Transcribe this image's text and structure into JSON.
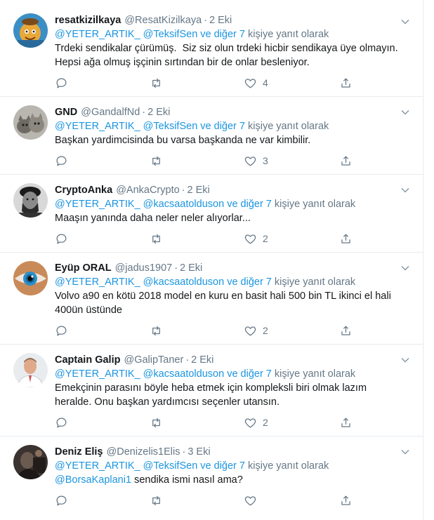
{
  "tweets": [
    {
      "name": "resatkizilkaya",
      "handle": "@ResatKizilkaya",
      "time": "2 Eki",
      "reply_to": {
        "m1": "@YETER_ARTIK_",
        "m2": "@TeksifSen",
        "others": "ve diğer 7",
        "suffix": "kişiye yanıt olarak"
      },
      "lines": [
        "Trdeki sendikalar çürümüş.  Siz siz olun trdeki hicbir sendikaya üye olmayın.",
        "Hepsi ağa olmuş işçinin sırtından bir de onlar besleniyor."
      ],
      "likes": "4",
      "avatar_icon": "cartoon-avatar"
    },
    {
      "name": "GND",
      "handle": "@GandalfNd",
      "time": "2 Eki",
      "reply_to": {
        "m1": "@YETER_ARTIK_",
        "m2": "@TeksifSen",
        "others": "ve diğer 7",
        "suffix": "kişiye yanıt olarak"
      },
      "lines": [
        "Başkan yardimcisinda bu varsa başkanda ne var kimbilir."
      ],
      "likes": "3",
      "avatar_icon": "cats-avatar"
    },
    {
      "name": "CryptoAnka",
      "handle": "@AnkaCrypto",
      "time": "2 Eki",
      "reply_to": {
        "m1": "@YETER_ARTIK_",
        "m2": "@kacsaatolduson",
        "others": "ve diğer 7",
        "suffix": "kişiye yanıt olarak"
      },
      "lines": [
        "Maaşın yanında daha neler neler alıyorlar..."
      ],
      "likes": "2",
      "avatar_icon": "portrait-bw-avatar"
    },
    {
      "name": "Eyüp ORAL",
      "handle": "@jadus1907",
      "time": "2 Eki",
      "reply_to": {
        "m1": "@YETER_ARTIK_",
        "m2": "@kacsaatolduson",
        "others": "ve diğer 7",
        "suffix": "kişiye yanıt olarak"
      },
      "lines": [
        "Volvo a90 en kötü 2018 model en kuru en basit hali 500 bin TL ikinci el hali",
        "400ün üstünde"
      ],
      "likes": "2",
      "avatar_icon": "eye-avatar"
    },
    {
      "name": "Captain Galip",
      "handle": "@GalipTaner",
      "time": "2 Eki",
      "reply_to": {
        "m1": "@YETER_ARTIK_",
        "m2": "@kacsaatolduson",
        "others": "ve diğer 7",
        "suffix": "kişiye yanıt olarak"
      },
      "lines": [
        "Emekçinin parasını böyle heba etmek için kompleksli biri olmak lazım",
        "heralde. Onu başkan yardımcısı seçenler utansın."
      ],
      "likes": "2",
      "avatar_icon": "doctor-avatar"
    },
    {
      "name": "Deniz Eliş",
      "handle": "@Denizelis1Elis",
      "time": "3 Eki",
      "reply_to": {
        "m1": "@YETER_ARTIK_",
        "m2": "@TeksifSen",
        "others": "ve diğer 7",
        "suffix": "kişiye yanıt olarak"
      },
      "lead_mention": "@BorsaKaplani1",
      "lines": [
        "sendika ismi nasıl ama?"
      ],
      "likes": "",
      "avatar_icon": "dark-photo-avatar"
    }
  ],
  "colors": {
    "link": "#1b95e0",
    "muted": "#657786",
    "text": "#14171a",
    "border": "#e6ecf0"
  }
}
